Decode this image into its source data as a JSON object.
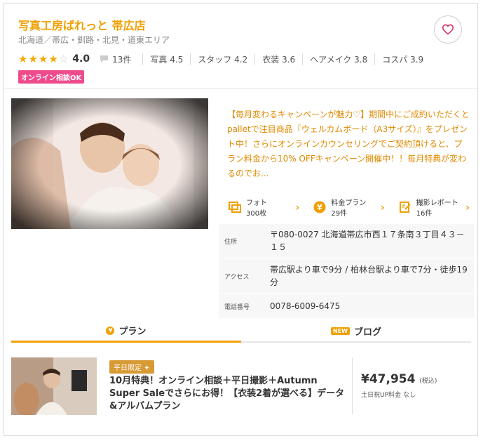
{
  "shop": {
    "name": "写真工房ぱれっと 帯広店",
    "area": "北海道／帯広・釧路・北見・道東エリア",
    "rating": "4.0",
    "stars_filled": 4,
    "stars_total": 5,
    "review_count": "13件",
    "metrics": [
      {
        "label": "写真",
        "value": "4.5"
      },
      {
        "label": "スタッフ",
        "value": "4.2"
      },
      {
        "label": "衣装",
        "value": "3.6"
      },
      {
        "label": "ヘアメイク",
        "value": "3.8"
      },
      {
        "label": "コスパ",
        "value": "3.9"
      }
    ],
    "badge": "オンライン相談OK",
    "description": "【毎月変わるキャンペーンが魅力♡】期間中にご成約いただくとpalletで注目商品『ウェルカムボード（A3サイズ）』をプレゼント中！さらにオンラインカウンセリングでご契約頂けると、プラン料金から10% OFFキャンペーン開催中！！毎月特典が変わるのでお..."
  },
  "links": [
    {
      "icon": "photo-icon",
      "label": "フォト",
      "value": "300",
      "unit": "枚"
    },
    {
      "icon": "yen-icon",
      "label": "料金プラン",
      "value": "29",
      "unit": "件"
    },
    {
      "icon": "report-icon",
      "label": "撮影レポート",
      "value": "16",
      "unit": "件"
    }
  ],
  "info": {
    "address_label": "住所",
    "address": "〒080-0027 北海道帯広市西１７条南３丁目４３－１５",
    "access_label": "アクセス",
    "access": "帯広駅より車で9分 / 柏林台駅より車で7分・徒歩19分",
    "phone_label": "電話番号",
    "phone": "0078-6009-6475"
  },
  "tabs": {
    "plan": "プラン",
    "blog": "ブログ",
    "new_badge": "NEW"
  },
  "plan": {
    "tag": "平日限定",
    "title": "10月特典！オンライン相談＋平日撮影＋Autumn Super Saleでさらにお得！【衣装2着が選べる】データ&アルバムプラン",
    "price": "¥47,954",
    "tax": "(税込)",
    "note": "土日祝UP料金 なし"
  },
  "colors": {
    "accent": "#f0a000",
    "badge": "#ee4b8d"
  }
}
